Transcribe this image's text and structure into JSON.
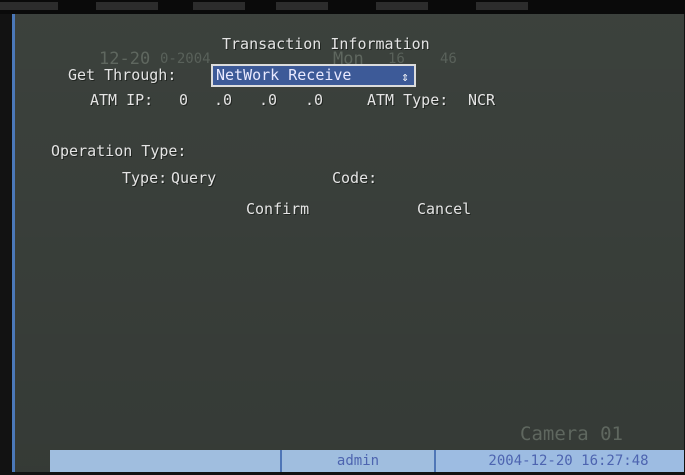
{
  "background": {
    "ghost_date": "12-20",
    "ghost_date_mid": "0-2004",
    "ghost_day": "Mon",
    "ghost_time": "16",
    "ghost_time_tail": "46"
  },
  "dialog": {
    "title": "Transaction Information",
    "get_through": {
      "label": "Get Through:",
      "value": "NetWork Receive",
      "arrow": "⇕"
    },
    "atm": {
      "ip_label": "ATM IP:",
      "ip_octets": [
        "0",
        ".0",
        ".0",
        ".0"
      ],
      "type_label": "ATM Type:",
      "type_value": "NCR"
    },
    "operation_type_label": "Operation Type:",
    "type_label": "Type:",
    "type_value": "Query",
    "code_label": "Code:",
    "code_value": "",
    "confirm_label": "Confirm",
    "cancel_label": "Cancel"
  },
  "status_bar": {
    "camera": "Camera 01",
    "user": "admin",
    "datetime": "2004-12-20 16:27:48"
  },
  "colors": {
    "screen_background": "#3e443f",
    "selected_field": "#3d5a98",
    "status_bar": "#a0bedf",
    "text": "#e4e4e4"
  }
}
